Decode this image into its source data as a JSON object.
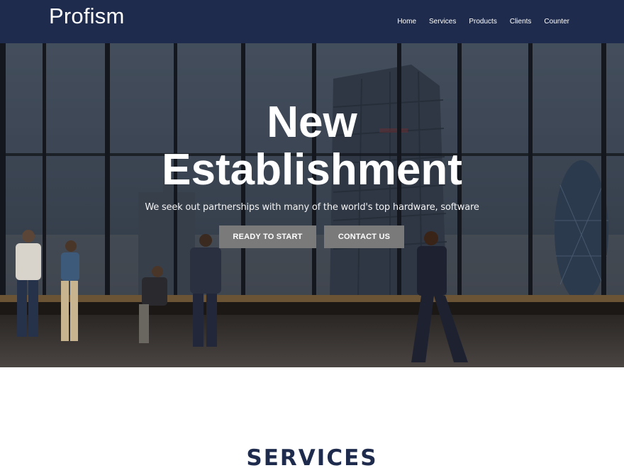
{
  "brand": "Profism",
  "nav": [
    {
      "label": "Home"
    },
    {
      "label": "Services"
    },
    {
      "label": "Products"
    },
    {
      "label": "Clients"
    },
    {
      "label": "Counter"
    }
  ],
  "hero": {
    "title_line1": "New",
    "title_line2": "Establishment",
    "subtitle": "We seek out partnerships with many of the world's top hardware, software",
    "buttons": {
      "start": "READY TO START",
      "contact": "CONTACT US"
    }
  },
  "services": {
    "heading": "SERVICES"
  },
  "colors": {
    "navbar": "#1e2b4c",
    "button": "#7a7a7a",
    "heading": "#1e2b4c"
  }
}
